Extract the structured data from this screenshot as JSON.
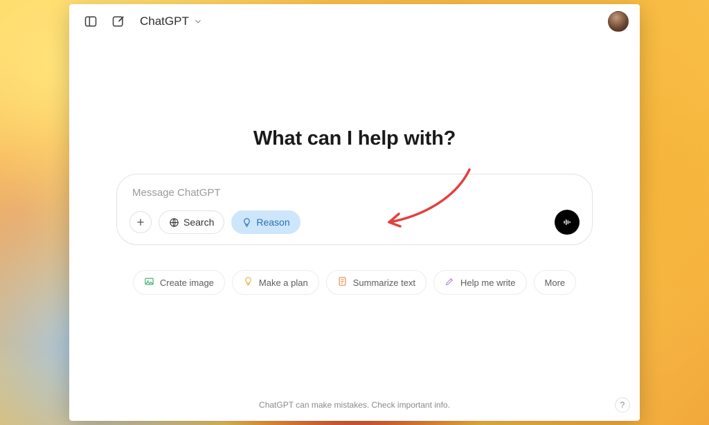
{
  "header": {
    "model_name": "ChatGPT"
  },
  "main": {
    "headline": "What can I help with?"
  },
  "composer": {
    "placeholder": "Message ChatGPT",
    "plus_label": "+",
    "search_label": "Search",
    "reason_label": "Reason"
  },
  "suggestions": [
    {
      "id": "create-image",
      "label": "Create image",
      "icon": "image-icon",
      "color": "c-green"
    },
    {
      "id": "make-a-plan",
      "label": "Make a plan",
      "icon": "lightbulb-icon",
      "color": "c-yellow"
    },
    {
      "id": "summarize-text",
      "label": "Summarize text",
      "icon": "doc-icon",
      "color": "c-orange"
    },
    {
      "id": "help-me-write",
      "label": "Help me write",
      "icon": "pen-icon",
      "color": "c-purple"
    },
    {
      "id": "more",
      "label": "More",
      "icon": null,
      "color": ""
    }
  ],
  "footer": {
    "disclaimer": "ChatGPT can make mistakes. Check important info.",
    "help_label": "?"
  }
}
